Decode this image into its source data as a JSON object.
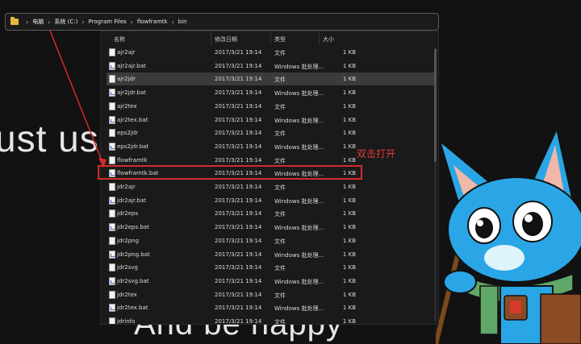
{
  "wallpaper": {
    "line1": "ust us",
    "line2": "And be happy"
  },
  "address_bar": {
    "crumbs": [
      "电脑",
      "系统 (C:)",
      "Program Files",
      "flowframtk",
      "bin"
    ],
    "separator": "›"
  },
  "columns": {
    "name": "名称",
    "date": "修改日期",
    "type": "类型",
    "size": "大小"
  },
  "files": [
    {
      "name": "ajr2ajr",
      "date": "2017/3/21 19:14",
      "type": "文件",
      "size": "1 KB",
      "kind": "file"
    },
    {
      "name": "ajr2ajr.bat",
      "date": "2017/3/21 19:14",
      "type": "Windows 批处理...",
      "size": "1 KB",
      "kind": "bat"
    },
    {
      "name": "ajr2jdr",
      "date": "2017/3/21 19:14",
      "type": "文件",
      "size": "1 KB",
      "kind": "file"
    },
    {
      "name": "ajr2jdr.bat",
      "date": "2017/3/21 19:14",
      "type": "Windows 批处理...",
      "size": "1 KB",
      "kind": "bat"
    },
    {
      "name": "ajr2tex",
      "date": "2017/3/21 19:14",
      "type": "文件",
      "size": "1 KB",
      "kind": "file"
    },
    {
      "name": "ajr2tex.bat",
      "date": "2017/3/21 19:14",
      "type": "Windows 批处理...",
      "size": "1 KB",
      "kind": "bat"
    },
    {
      "name": "eps2jdr",
      "date": "2017/3/21 19:14",
      "type": "文件",
      "size": "1 KB",
      "kind": "file"
    },
    {
      "name": "eps2jdr.bat",
      "date": "2017/3/21 19:14",
      "type": "Windows 批处理...",
      "size": "1 KB",
      "kind": "bat"
    },
    {
      "name": "flowframtk",
      "date": "2017/3/21 19:14",
      "type": "文件",
      "size": "1 KB",
      "kind": "file"
    },
    {
      "name": "flowframtk.bat",
      "date": "2017/3/21 19:14",
      "type": "Windows 批处理...",
      "size": "1 KB",
      "kind": "bat"
    },
    {
      "name": "jdr2ajr",
      "date": "2017/3/21 19:14",
      "type": "文件",
      "size": "1 KB",
      "kind": "file"
    },
    {
      "name": "jdr2ajr.bat",
      "date": "2017/3/21 19:14",
      "type": "Windows 批处理...",
      "size": "1 KB",
      "kind": "bat"
    },
    {
      "name": "jdr2eps",
      "date": "2017/3/21 19:14",
      "type": "文件",
      "size": "1 KB",
      "kind": "file"
    },
    {
      "name": "jdr2eps.bat",
      "date": "2017/3/21 19:14",
      "type": "Windows 批处理...",
      "size": "1 KB",
      "kind": "bat"
    },
    {
      "name": "jdr2png",
      "date": "2017/3/21 19:14",
      "type": "文件",
      "size": "1 KB",
      "kind": "file"
    },
    {
      "name": "jdr2png.bat",
      "date": "2017/3/21 19:14",
      "type": "Windows 批处理...",
      "size": "1 KB",
      "kind": "bat"
    },
    {
      "name": "jdr2svg",
      "date": "2017/3/21 19:14",
      "type": "文件",
      "size": "1 KB",
      "kind": "file"
    },
    {
      "name": "jdr2svg.bat",
      "date": "2017/3/21 19:14",
      "type": "Windows 批处理...",
      "size": "1 KB",
      "kind": "bat"
    },
    {
      "name": "jdr2tex",
      "date": "2017/3/21 19:14",
      "type": "文件",
      "size": "1 KB",
      "kind": "file"
    },
    {
      "name": "jdr2tex.bat",
      "date": "2017/3/21 19:14",
      "type": "Windows 批处理...",
      "size": "1 KB",
      "kind": "bat"
    },
    {
      "name": "jdrinfo",
      "date": "2017/3/21 19:14",
      "type": "文件",
      "size": "1 KB",
      "kind": "file"
    }
  ],
  "selected_index": 2,
  "highlighted_index": 9,
  "annotation": {
    "text": "双击打开",
    "color": "#e53a3a"
  }
}
